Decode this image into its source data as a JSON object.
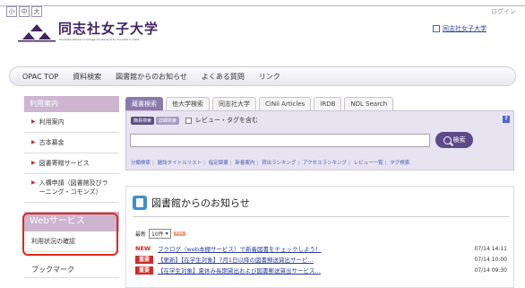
{
  "header": {
    "font_sizes": [
      "小",
      "中",
      "大"
    ],
    "login": "ログイン",
    "logo_title": "同志社女子大学",
    "logo_subtitle": "Doshisha Women's College of Liberal Arts, Founded in 1876",
    "university_link": "同志社女子大学"
  },
  "nav": {
    "items": [
      "OPAC TOP",
      "資料検索",
      "図書館からのお知らせ",
      "よくある質問",
      "リンク"
    ]
  },
  "sidebar": {
    "heading": "利用案内",
    "items": [
      {
        "label": "利用案内"
      },
      {
        "label": "古本募金"
      },
      {
        "label": "図書寄贈サービス"
      },
      {
        "label": "入構申請（図書館及びラーニング・コモンズ）"
      }
    ],
    "web_heading": "Webサービス",
    "web_item": "利用状況の確認",
    "bookmark": "ブックマーク"
  },
  "search": {
    "tabs": [
      "蔵書検索",
      "他大学検索",
      "同志社大学",
      "CiNii Articles",
      "IRDB",
      "NDL Search"
    ],
    "active_tab": 0,
    "simple_label": "簡易検索",
    "detail_label": "詳細検索",
    "review_label": "レビュー・タグを含む",
    "help_icon": "?",
    "go_label": "検索",
    "links": [
      "分類検索",
      "雑誌タイトルリスト",
      "指定図書",
      "新着案内",
      "貸出ランキング",
      "アクセスランキング",
      "レビュー一覧",
      "タグ検索"
    ]
  },
  "news": {
    "title": "図書館からのお知らせ",
    "limit_label": "最新",
    "limit_value": "10件",
    "rss": "RSS",
    "items": [
      {
        "tag": "NEW",
        "title": "ブクログ（web本棚サービス）で新着図書をチェックしよう！",
        "date": "07/14 14:11"
      },
      {
        "tag": "重要",
        "title": "【更新】【在学生対象】7月1日以降の図書郵送貸出サービ…",
        "date": "07/14 10:00"
      },
      {
        "tag": "重要",
        "title": "【在学生対象】夏休み長期貸出および図書郵送貸出サービス…",
        "date": "07/14 09:30"
      }
    ]
  },
  "colors": {
    "brand_purple": "#402562",
    "sidebar_head": "#cdb4cf",
    "tab_active": "#8a7aad",
    "highlight_red": "#e1281e"
  }
}
